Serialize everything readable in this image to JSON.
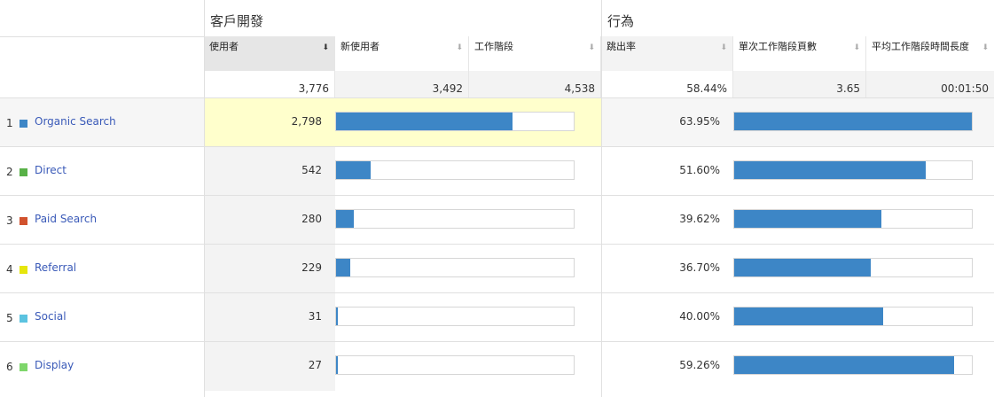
{
  "groups": {
    "acquisition": "客戶開發",
    "behavior": "行為"
  },
  "columns": {
    "users": "使用者",
    "new_users": "新使用者",
    "sessions": "工作階段",
    "bounce_rate": "跳出率",
    "pages_per_session": "單次工作階段頁數",
    "avg_session_duration": "平均工作階段時間長度"
  },
  "sort_icon": "sort-arrow-icon",
  "totals": {
    "users": "3,776",
    "new_users": "3,492",
    "sessions": "4,538",
    "bounce_rate": "58.44%",
    "pages_per_session": "3.65",
    "avg_session_duration": "00:01:50"
  },
  "rows": [
    {
      "index": "1",
      "label": "Organic Search",
      "color": "#3d86c6",
      "users": "2,798",
      "users_share": 0.741,
      "bounce": "63.95%",
      "bounce_share": 1.0
    },
    {
      "index": "2",
      "label": "Direct",
      "color": "#58b147",
      "users": "542",
      "users_share": 0.144,
      "bounce": "51.60%",
      "bounce_share": 0.807
    },
    {
      "index": "3",
      "label": "Paid Search",
      "color": "#d1522e",
      "users": "280",
      "users_share": 0.074,
      "bounce": "39.62%",
      "bounce_share": 0.62
    },
    {
      "index": "4",
      "label": "Referral",
      "color": "#e6e60c",
      "users": "229",
      "users_share": 0.061,
      "bounce": "36.70%",
      "bounce_share": 0.574
    },
    {
      "index": "5",
      "label": "Social",
      "color": "#5bc3e0",
      "users": "31",
      "users_share": 0.008,
      "bounce": "40.00%",
      "bounce_share": 0.626
    },
    {
      "index": "6",
      "label": "Display",
      "color": "#7ed66b",
      "users": "27",
      "users_share": 0.007,
      "bounce": "59.26%",
      "bounce_share": 0.927
    }
  ]
}
